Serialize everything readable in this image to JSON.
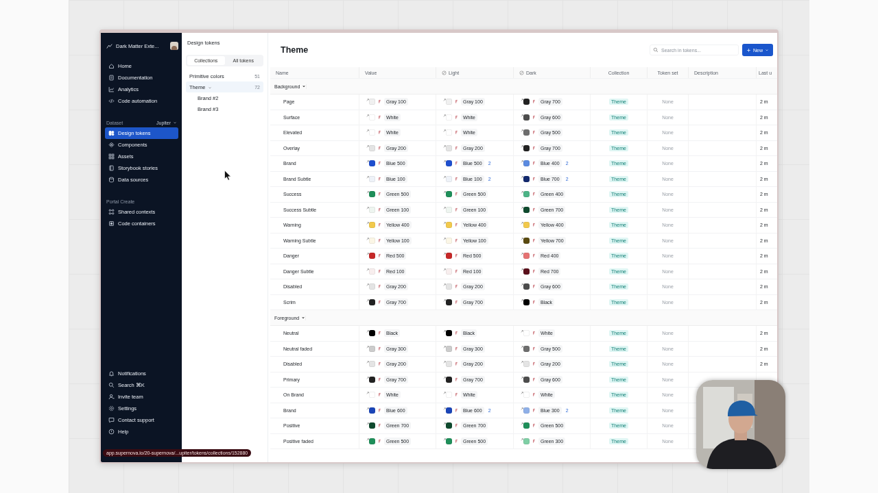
{
  "workspace": {
    "name": "Dark Matter Exte..."
  },
  "nav": [
    {
      "label": "Home",
      "selected": false
    },
    {
      "label": "Documentation",
      "selected": false
    },
    {
      "label": "Analytics",
      "selected": false
    },
    {
      "label": "Code automation",
      "selected": false
    }
  ],
  "dataset": {
    "label": "Dataset",
    "value": "Jupiter"
  },
  "dataset_nav": [
    {
      "label": "Design tokens",
      "selected": true
    },
    {
      "label": "Components",
      "selected": false
    },
    {
      "label": "Assets",
      "selected": false
    },
    {
      "label": "Storybook stories",
      "selected": false
    },
    {
      "label": "Data sources",
      "selected": false
    }
  ],
  "portal": {
    "label": "Portal Create"
  },
  "portal_nav": [
    {
      "label": "Shared contexts",
      "selected": false
    },
    {
      "label": "Code containers",
      "selected": false
    }
  ],
  "footer_nav": [
    {
      "label": "Notifications",
      "selected": false
    },
    {
      "label": "Search ⌘K",
      "selected": false
    },
    {
      "label": "Invite team",
      "selected": false
    },
    {
      "label": "Settings",
      "selected": false
    },
    {
      "label": "Contact support",
      "selected": false
    },
    {
      "label": "Help",
      "selected": false
    }
  ],
  "status_url": "app.supernova.io/20-supernova/...upiter/tokens/collections/152880",
  "panel": {
    "title": "Design tokens",
    "tabs": [
      {
        "label": "Collections",
        "selected": true
      },
      {
        "label": "All tokens",
        "selected": false
      }
    ],
    "collections": [
      {
        "label": "Primitive colors",
        "count": "51",
        "selected": false
      },
      {
        "label": "Theme",
        "count": "72",
        "selected": true,
        "expanded": true,
        "children": [
          {
            "label": "Brand #2",
            "selected": false
          },
          {
            "label": "Brand #3",
            "selected": false
          }
        ]
      }
    ]
  },
  "page": {
    "title": "Theme",
    "search": {
      "placeholder": "Search in tokens..."
    },
    "new_button": "New"
  },
  "table": {
    "columns": [
      "Name",
      "Value",
      "Light",
      "Dark",
      "Collection",
      "Token set",
      "Description",
      "Last u"
    ],
    "groups": [
      {
        "label": "Background",
        "expanded": true,
        "rows": [
          {
            "name": "Page",
            "value": {
              "label": "Gray 100",
              "color": "#f0f0f0"
            },
            "light": {
              "label": "Gray 100",
              "color": "#f0f0f0"
            },
            "dark": {
              "label": "Gray 700",
              "color": "#222222"
            },
            "collection": "Theme",
            "token_set": "None",
            "updated": "2 m"
          },
          {
            "name": "Surface",
            "value": {
              "label": "White",
              "color": "#ffffff"
            },
            "light": {
              "label": "White",
              "color": "#ffffff"
            },
            "dark": {
              "label": "Gray 600",
              "color": "#4d4d4d"
            },
            "collection": "Theme",
            "token_set": "None",
            "updated": "2 m"
          },
          {
            "name": "Elevated",
            "value": {
              "label": "White",
              "color": "#ffffff"
            },
            "light": {
              "label": "White",
              "color": "#ffffff"
            },
            "dark": {
              "label": "Gray 500",
              "color": "#6e6e6e"
            },
            "collection": "Theme",
            "token_set": "None",
            "updated": "2 m"
          },
          {
            "name": "Overlay",
            "value": {
              "label": "Gray 200",
              "color": "#e4e4e4"
            },
            "light": {
              "label": "Gray 200",
              "color": "#e4e4e4"
            },
            "dark": {
              "label": "Gray 700",
              "color": "#222222"
            },
            "collection": "Theme",
            "token_set": "None",
            "updated": "2 m"
          },
          {
            "name": "Brand",
            "value": {
              "label": "Blue 500",
              "color": "#1f4fcf"
            },
            "light": {
              "label": "Blue 500",
              "color": "#1f4fcf",
              "count": "2"
            },
            "dark": {
              "label": "Blue 400",
              "color": "#5b8be0",
              "count": "2"
            },
            "collection": "Theme",
            "token_set": "None",
            "updated": "2 m"
          },
          {
            "name": "Brand Subtle",
            "value": {
              "label": "Blue 100",
              "color": "#eef2f8"
            },
            "light": {
              "label": "Blue 100",
              "color": "#eef2f8",
              "count": "2"
            },
            "dark": {
              "label": "Blue 700",
              "color": "#13296e",
              "count": "2"
            },
            "collection": "Theme",
            "token_set": "None",
            "updated": "2 m"
          },
          {
            "name": "Success",
            "value": {
              "label": "Green 500",
              "color": "#1f8f5a"
            },
            "light": {
              "label": "Green 500",
              "color": "#1f8f5a"
            },
            "dark": {
              "label": "Green 400",
              "color": "#4cb386"
            },
            "collection": "Theme",
            "token_set": "None",
            "updated": "2 m"
          },
          {
            "name": "Success Subtle",
            "value": {
              "label": "Green 100",
              "color": "#eef5f0"
            },
            "light": {
              "label": "Green 100",
              "color": "#eef5f0"
            },
            "dark": {
              "label": "Green 700",
              "color": "#0f4a2e"
            },
            "collection": "Theme",
            "token_set": "None",
            "updated": "2 m"
          },
          {
            "name": "Warning",
            "value": {
              "label": "Yellow 400",
              "color": "#f2c94c"
            },
            "light": {
              "label": "Yellow 400",
              "color": "#f2c94c"
            },
            "dark": {
              "label": "Yellow 400",
              "color": "#f2c94c"
            },
            "collection": "Theme",
            "token_set": "None",
            "updated": "2 m"
          },
          {
            "name": "Warning Subtle",
            "value": {
              "label": "Yellow 100",
              "color": "#fbf6e6"
            },
            "light": {
              "label": "Yellow 100",
              "color": "#fbf6e6"
            },
            "dark": {
              "label": "Yellow 700",
              "color": "#5a4a10"
            },
            "collection": "Theme",
            "token_set": "None",
            "updated": "2 m"
          },
          {
            "name": "Danger",
            "value": {
              "label": "Red 500",
              "color": "#c62828"
            },
            "light": {
              "label": "Red 500",
              "color": "#c62828"
            },
            "dark": {
              "label": "Red 400",
              "color": "#e57373"
            },
            "collection": "Theme",
            "token_set": "None",
            "updated": "2 m"
          },
          {
            "name": "Danger Subtle",
            "value": {
              "label": "Red 100",
              "color": "#f8eeee"
            },
            "light": {
              "label": "Red 100",
              "color": "#f8eeee"
            },
            "dark": {
              "label": "Red 700",
              "color": "#5a0f1a"
            },
            "collection": "Theme",
            "token_set": "None",
            "updated": "2 m"
          },
          {
            "name": "Disabled",
            "value": {
              "label": "Gray 200",
              "color": "#e4e4e4"
            },
            "light": {
              "label": "Gray 200",
              "color": "#e4e4e4"
            },
            "dark": {
              "label": "Gray 600",
              "color": "#4d4d4d"
            },
            "collection": "Theme",
            "token_set": "None",
            "updated": "2 m"
          },
          {
            "name": "Scrim",
            "value": {
              "label": "Gray 700",
              "color": "#222222"
            },
            "light": {
              "label": "Gray 700",
              "color": "#222222"
            },
            "dark": {
              "label": "Black",
              "color": "#000000"
            },
            "collection": "Theme",
            "token_set": "None",
            "updated": "2 m"
          }
        ]
      },
      {
        "label": "Foreground",
        "expanded": true,
        "rows": [
          {
            "name": "Neutral",
            "value": {
              "label": "Black",
              "color": "#000000"
            },
            "light": {
              "label": "Black",
              "color": "#000000"
            },
            "dark": {
              "label": "White",
              "color": "#ffffff"
            },
            "collection": "Theme",
            "token_set": "None",
            "updated": "2 m"
          },
          {
            "name": "Neutral faded",
            "value": {
              "label": "Gray 300",
              "color": "#cccccc"
            },
            "light": {
              "label": "Gray 300",
              "color": "#cccccc"
            },
            "dark": {
              "label": "Gray 500",
              "color": "#6e6e6e"
            },
            "collection": "Theme",
            "token_set": "None",
            "updated": "2 m"
          },
          {
            "name": "Disabled",
            "value": {
              "label": "Gray 200",
              "color": "#e4e4e4"
            },
            "light": {
              "label": "Gray 200",
              "color": "#e4e4e4"
            },
            "dark": {
              "label": "Gray 200",
              "color": "#e4e4e4"
            },
            "collection": "Theme",
            "token_set": "None",
            "updated": "2 m"
          },
          {
            "name": "Primary",
            "value": {
              "label": "Gray 700",
              "color": "#222222"
            },
            "light": {
              "label": "Gray 700",
              "color": "#222222"
            },
            "dark": {
              "label": "Gray 600",
              "color": "#4d4d4d"
            },
            "collection": "Theme",
            "token_set": "None"
          },
          {
            "name": "On Brand",
            "value": {
              "label": "White",
              "color": "#ffffff"
            },
            "light": {
              "label": "White",
              "color": "#ffffff"
            },
            "dark": {
              "label": "White",
              "color": "#ffffff"
            },
            "collection": "Theme",
            "token_set": "None"
          },
          {
            "name": "Brand",
            "value": {
              "label": "Blue 600",
              "color": "#1a45b8"
            },
            "light": {
              "label": "Blue 600",
              "color": "#1a45b8",
              "count": "2"
            },
            "dark": {
              "label": "Blue 300",
              "color": "#8fb0e8",
              "count": "2"
            },
            "collection": "Theme",
            "token_set": "None"
          },
          {
            "name": "Positive",
            "value": {
              "label": "Green 700",
              "color": "#0f4a2e"
            },
            "light": {
              "label": "Green 700",
              "color": "#0f4a2e"
            },
            "dark": {
              "label": "Green 500",
              "color": "#1f8f5a"
            },
            "collection": "Theme",
            "token_set": "None"
          },
          {
            "name": "Positive faded",
            "value": {
              "label": "Green 500",
              "color": "#1f8f5a"
            },
            "light": {
              "label": "Green 500",
              "color": "#1f8f5a"
            },
            "dark": {
              "label": "Green 300",
              "color": "#7fcfa5"
            },
            "collection": "Theme",
            "token_set": "None"
          }
        ]
      }
    ]
  }
}
